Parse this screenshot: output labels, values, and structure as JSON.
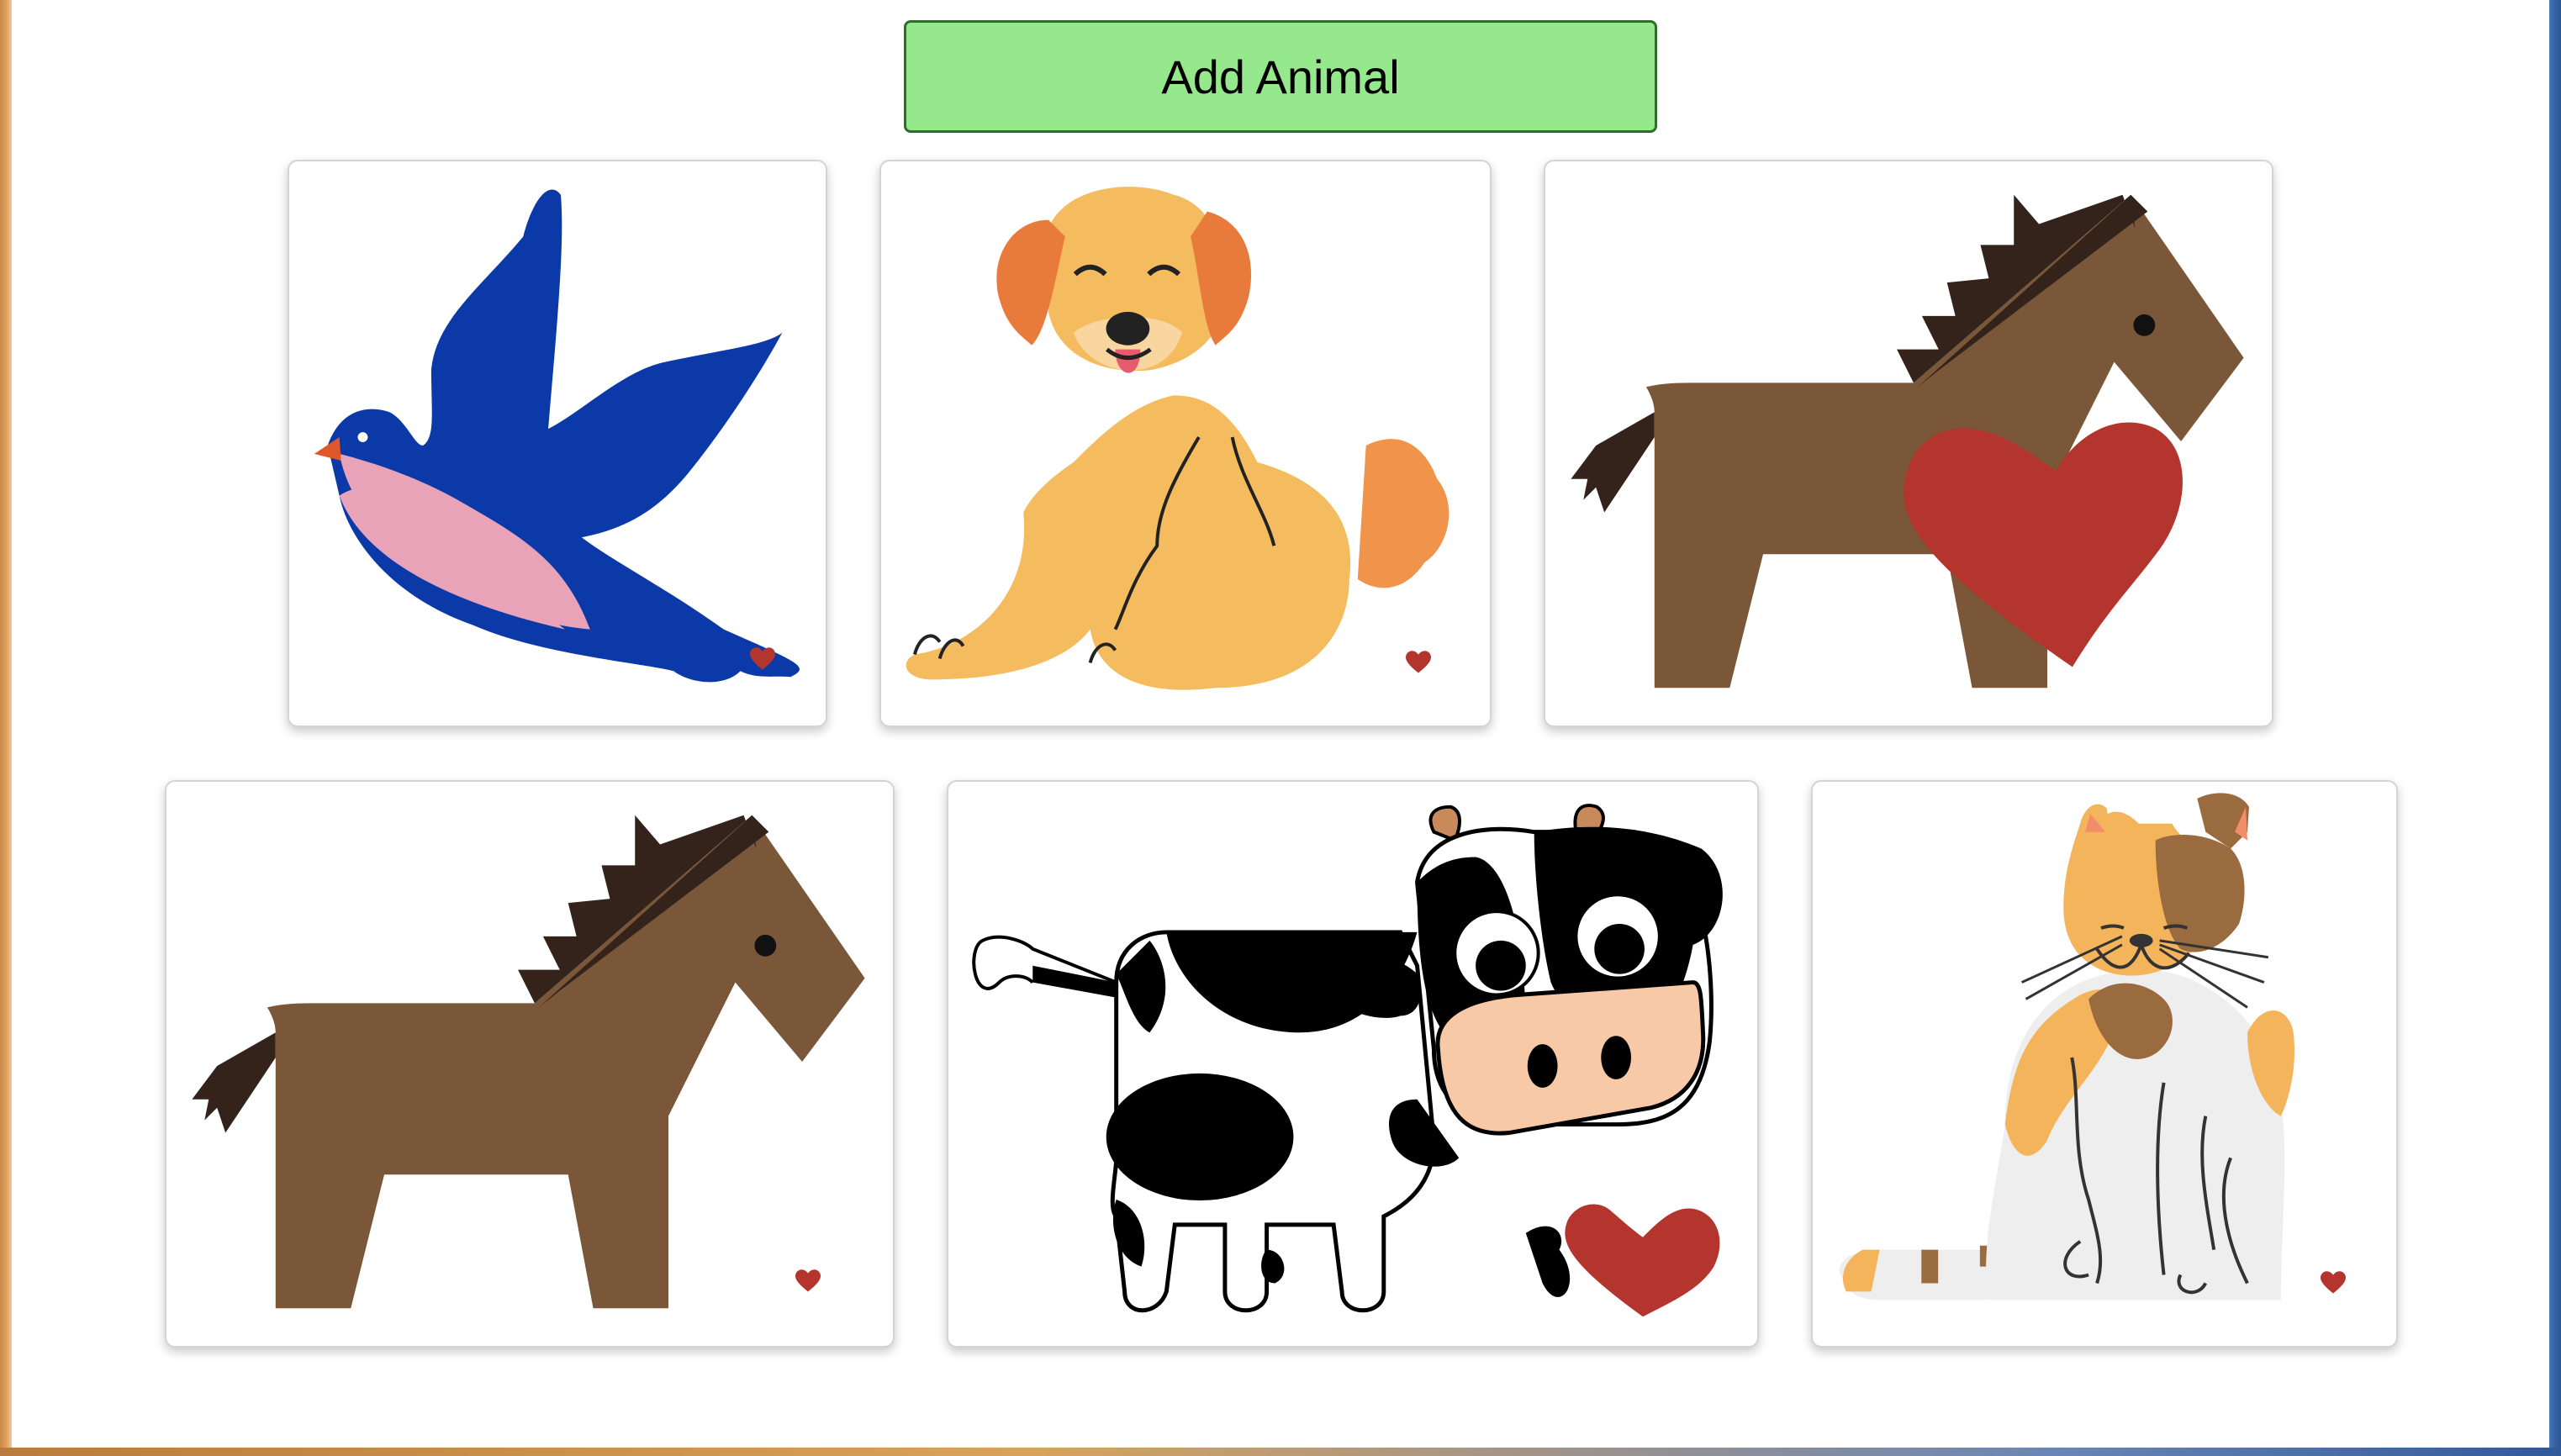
{
  "toolbar": {
    "add_label": "Add Animal"
  },
  "cards": [
    {
      "animal": "bird",
      "liked": false
    },
    {
      "animal": "dog",
      "liked": false
    },
    {
      "animal": "horse",
      "liked": true
    },
    {
      "animal": "horse",
      "liked": false
    },
    {
      "animal": "cow",
      "liked": true
    },
    {
      "animal": "cat",
      "liked": false
    }
  ],
  "colors": {
    "button_bg": "#96e88d",
    "heart": "#b3352e",
    "horse_body": "#7a5738",
    "horse_mane": "#33231a",
    "bird_blue": "#0b3aa8",
    "bird_belly": "#e9a3b8",
    "dog_fur": "#f4bc5e",
    "dog_ear": "#e87b3c",
    "cow_spot": "#000000",
    "cow_muzzle": "#f8c9a7"
  }
}
